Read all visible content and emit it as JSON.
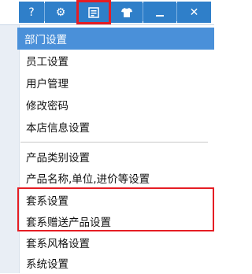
{
  "toolbar": {
    "buttons": [
      {
        "name": "help-icon",
        "glyph": "?"
      },
      {
        "name": "gear-icon",
        "glyph": "⚙"
      },
      {
        "name": "settings-menu-icon",
        "glyph": ""
      },
      {
        "name": "skin-icon",
        "glyph": ""
      },
      {
        "name": "minimize-icon",
        "glyph": "—"
      },
      {
        "name": "close-icon",
        "glyph": "✕"
      }
    ],
    "accent_color": "#2f7fc9",
    "highlight_color": "#e51d24"
  },
  "menu": {
    "items": [
      {
        "label": "部门设置"
      },
      {
        "label": "员工设置"
      },
      {
        "label": "用户管理"
      },
      {
        "label": "修改密码"
      },
      {
        "label": "本店信息设置"
      },
      {
        "label": "产品类别设置"
      },
      {
        "label": "产品名称,单位,进价等设置"
      },
      {
        "label": "套系设置"
      },
      {
        "label": "套系赠送产品设置"
      },
      {
        "label": "套系风格设置"
      },
      {
        "label": "系统设置"
      }
    ],
    "active_color": "#4a90d9"
  }
}
